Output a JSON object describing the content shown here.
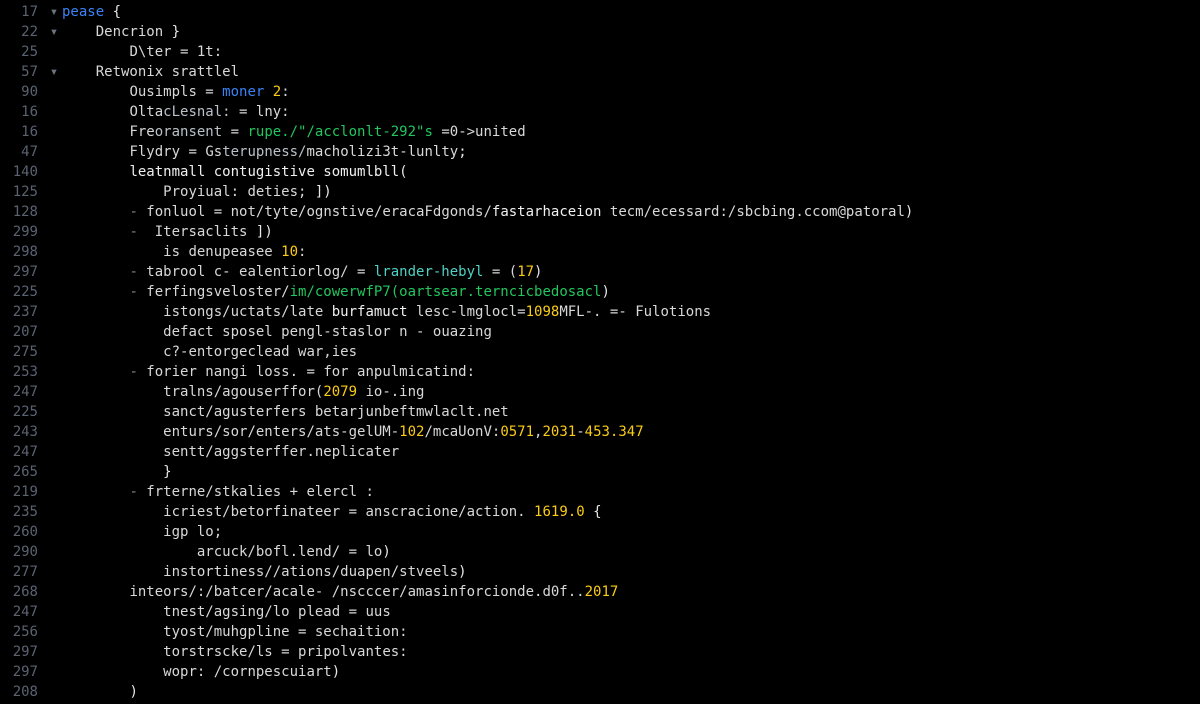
{
  "editor": {
    "gutter_fold_glyph": "▾",
    "lines": [
      {
        "num": "17",
        "fold": true,
        "indent": 0,
        "tokens": [
          [
            "kw",
            "pease"
          ],
          [
            "id",
            " "
          ],
          [
            "brace",
            "{"
          ]
        ]
      },
      {
        "num": "22",
        "fold": true,
        "indent": 1,
        "tokens": [
          [
            "id",
            "Dencrion "
          ],
          [
            "brace",
            "}"
          ]
        ]
      },
      {
        "num": "25",
        "fold": false,
        "indent": 2,
        "tokens": [
          [
            "id",
            "D\\ter "
          ],
          [
            "eq",
            "="
          ],
          [
            "id",
            " 1t:"
          ]
        ]
      },
      {
        "num": "57",
        "fold": true,
        "indent": 1,
        "tokens": [
          [
            "id",
            "Retwonix srattlel"
          ]
        ]
      },
      {
        "num": "90",
        "fold": false,
        "indent": 2,
        "tokens": [
          [
            "id",
            "Ousimpls "
          ],
          [
            "eq",
            "="
          ],
          [
            "kw",
            " moner "
          ],
          [
            "num",
            "2"
          ],
          [
            "id",
            ":"
          ]
        ]
      },
      {
        "num": "16",
        "fold": false,
        "indent": 2,
        "tokens": [
          [
            "id",
            "Olta"
          ],
          [
            "pale",
            "cLesnal:"
          ],
          [
            "id",
            " "
          ],
          [
            "eq",
            "="
          ],
          [
            "id",
            " lny:"
          ]
        ]
      },
      {
        "num": "16",
        "fold": false,
        "indent": 2,
        "tokens": [
          [
            "id",
            "Fre"
          ],
          [
            "pale",
            "oransent "
          ],
          [
            "eq",
            "="
          ],
          [
            "str",
            " rupe./\"/acclonlt-292\"s "
          ],
          [
            "eq",
            "="
          ],
          [
            "id",
            "0->united"
          ]
        ]
      },
      {
        "num": "47",
        "fold": false,
        "indent": 2,
        "tokens": [
          [
            "id",
            "Flydry "
          ],
          [
            "eq",
            "="
          ],
          [
            "id",
            " Gs"
          ],
          [
            "pale",
            "terupness/"
          ],
          [
            "id",
            "macholizi3t-lunlty"
          ],
          [
            "brace",
            ";"
          ]
        ]
      },
      {
        "num": "140",
        "fold": false,
        "indent": 2,
        "tokens": [
          [
            "lit",
            "leatnmall contugistive somumlbll"
          ],
          [
            "brace",
            "("
          ]
        ]
      },
      {
        "num": "125",
        "fold": false,
        "indent": 3,
        "tokens": [
          [
            "id",
            "Proyiual: deties; "
          ],
          [
            "brace",
            "])"
          ]
        ]
      },
      {
        "num": "128",
        "fold": false,
        "indent": 2,
        "tokens": [
          [
            "dim",
            "- "
          ],
          [
            "id",
            "fonluol "
          ],
          [
            "eq",
            "="
          ],
          [
            "id",
            " not/tyte/ognstive/eracaFdgonds/"
          ],
          [
            "lit",
            "fastarhaceion"
          ],
          [
            "id",
            " tecm/ecessard:/sbcbing.ccom@patoral"
          ],
          [
            "brace",
            ")"
          ]
        ]
      },
      {
        "num": "299",
        "fold": false,
        "indent": 2,
        "tokens": [
          [
            "dim",
            "-  "
          ],
          [
            "id",
            "Itersaclits "
          ],
          [
            "brace",
            "])"
          ]
        ]
      },
      {
        "num": "298",
        "fold": false,
        "indent": 3,
        "tokens": [
          [
            "id",
            "is denupeasee "
          ],
          [
            "num",
            "10"
          ],
          [
            "id",
            ":"
          ]
        ]
      },
      {
        "num": "297",
        "fold": false,
        "indent": 2,
        "tokens": [
          [
            "dim",
            "- "
          ],
          [
            "id",
            "tabrool c- ealentiorlog/ "
          ],
          [
            "eq",
            "="
          ],
          [
            "teal",
            " lrander-hebyl "
          ],
          [
            "eq",
            "="
          ],
          [
            "id",
            " ("
          ],
          [
            "num",
            "17"
          ],
          [
            "brace",
            ")"
          ]
        ]
      },
      {
        "num": "225",
        "fold": false,
        "indent": 2,
        "tokens": [
          [
            "dim",
            "- "
          ],
          [
            "id",
            "ferfingsveloster/"
          ],
          [
            "str",
            "im/cowerwfP7(oartsear.terncicbedosacl"
          ],
          [
            "brace",
            ")"
          ]
        ]
      },
      {
        "num": "237",
        "fold": false,
        "indent": 3,
        "tokens": [
          [
            "id",
            "istongs/uctats/late "
          ],
          [
            "lit",
            "burfamuct"
          ],
          [
            "id",
            " lesc-lmglocl="
          ],
          [
            "num",
            "1098"
          ],
          [
            "id",
            "MFL-. "
          ],
          [
            "eq",
            "=-"
          ],
          [
            "id",
            " Fulotions"
          ]
        ]
      },
      {
        "num": "207",
        "fold": false,
        "indent": 3,
        "tokens": [
          [
            "id",
            "defact sposel pengl-staslor n "
          ],
          [
            "eq",
            "-"
          ],
          [
            "id",
            " ouazing"
          ]
        ]
      },
      {
        "num": "275",
        "fold": false,
        "indent": 3,
        "tokens": [
          [
            "id",
            "c?-entorgeclead war,ies"
          ]
        ]
      },
      {
        "num": "253",
        "fold": false,
        "indent": 2,
        "tokens": [
          [
            "dim",
            "- "
          ],
          [
            "id",
            "forier nangi loss. "
          ],
          [
            "eq",
            "="
          ],
          [
            "id",
            " for anpulmicatind:"
          ]
        ]
      },
      {
        "num": "247",
        "fold": false,
        "indent": 3,
        "tokens": [
          [
            "id",
            "tralns/agouserffor("
          ],
          [
            "num",
            "2079"
          ],
          [
            "id",
            " io-.ing"
          ]
        ]
      },
      {
        "num": "225",
        "fold": false,
        "indent": 3,
        "tokens": [
          [
            "id",
            "sanct/agusterfers betarjunbeftmwlaclt.net"
          ]
        ]
      },
      {
        "num": "243",
        "fold": false,
        "indent": 3,
        "tokens": [
          [
            "id",
            "enturs/sor/enters/ats-gelUM-"
          ],
          [
            "num",
            "102"
          ],
          [
            "id",
            "/mcaUonV:"
          ],
          [
            "num",
            "0571"
          ],
          [
            "id",
            ","
          ],
          [
            "num",
            "2031"
          ],
          [
            "id",
            "-"
          ],
          [
            "num",
            "453.347"
          ]
        ]
      },
      {
        "num": "247",
        "fold": false,
        "indent": 3,
        "tokens": [
          [
            "id",
            "sentt/aggsterffer.neplicater"
          ]
        ]
      },
      {
        "num": "265",
        "fold": false,
        "indent": 3,
        "tokens": [
          [
            "brace",
            "}"
          ]
        ]
      },
      {
        "num": "219",
        "fold": false,
        "indent": 2,
        "tokens": [
          [
            "dim",
            "- "
          ],
          [
            "id",
            "frterne/stkalies "
          ],
          [
            "eq",
            "+"
          ],
          [
            "id",
            " elercl :"
          ]
        ]
      },
      {
        "num": "235",
        "fold": false,
        "indent": 3,
        "tokens": [
          [
            "id",
            "icriest/betorfinateer "
          ],
          [
            "eq",
            "="
          ],
          [
            "id",
            " anscracione/action. "
          ],
          [
            "num",
            "1619.0"
          ],
          [
            "id",
            " "
          ],
          [
            "brace",
            "{"
          ]
        ]
      },
      {
        "num": "260",
        "fold": false,
        "indent": 3,
        "tokens": [
          [
            "id",
            "igp lo;"
          ]
        ]
      },
      {
        "num": "290",
        "fold": false,
        "indent": 4,
        "tokens": [
          [
            "id",
            "arcuck/bofl.lend/ "
          ],
          [
            "eq",
            "="
          ],
          [
            "id",
            " lo"
          ],
          [
            "brace",
            ")"
          ]
        ]
      },
      {
        "num": "277",
        "fold": false,
        "indent": 3,
        "tokens": [
          [
            "id",
            "instortiness//ations/duapen/stveels"
          ],
          [
            "brace",
            ")"
          ]
        ]
      },
      {
        "num": "268",
        "fold": false,
        "indent": 2,
        "tokens": [
          [
            "id",
            "inteors/:/batcer/acale- /nscccer/amasinforcionde.d0f.."
          ],
          [
            "num",
            "2017"
          ]
        ]
      },
      {
        "num": "247",
        "fold": false,
        "indent": 3,
        "tokens": [
          [
            "id",
            "tnest/agsing/lo plead "
          ],
          [
            "eq",
            "="
          ],
          [
            "id",
            " uus"
          ]
        ]
      },
      {
        "num": "256",
        "fold": false,
        "indent": 3,
        "tokens": [
          [
            "id",
            "tyost/muhgpline "
          ],
          [
            "eq",
            "="
          ],
          [
            "id",
            " sechaition:"
          ]
        ]
      },
      {
        "num": "297",
        "fold": false,
        "indent": 3,
        "tokens": [
          [
            "id",
            "torstrscke/ls "
          ],
          [
            "eq",
            "="
          ],
          [
            "id",
            " pripolvantes:"
          ]
        ]
      },
      {
        "num": "297",
        "fold": false,
        "indent": 3,
        "tokens": [
          [
            "id",
            "wopr: /cornpescuiart"
          ],
          [
            "brace",
            ")"
          ]
        ]
      },
      {
        "num": "208",
        "fold": false,
        "indent": 2,
        "tokens": [
          [
            "brace",
            ")"
          ]
        ]
      }
    ]
  }
}
